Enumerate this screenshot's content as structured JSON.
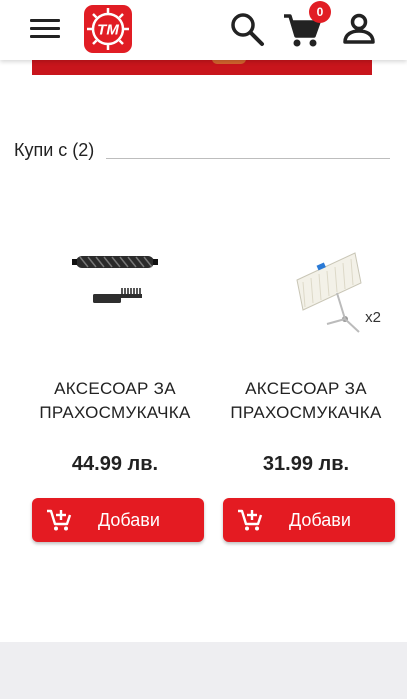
{
  "header": {
    "logo_text": "TM",
    "cart_count": "0",
    "icons": {
      "menu": "hamburger-menu-icon",
      "search": "search-icon",
      "cart": "shopping-cart-icon",
      "account": "account-icon"
    }
  },
  "section": {
    "title": "Купи с (2)"
  },
  "products": [
    {
      "name": "АКСЕСОАР ЗА ПРАХОСМУКАЧКА",
      "price": "44.99 лв.",
      "button_label": "Добави",
      "image": "roller-brush-and-cleaning-tool"
    },
    {
      "name": "АКСЕСОАР ЗА ПРАХОСМУКАЧКА",
      "price": "31.99 лв.",
      "button_label": "Добави",
      "image": "filter-and-side-brush",
      "image_label": "x2"
    }
  ],
  "colors": {
    "brand_red": "#e11d24",
    "button_red": "#e41b22",
    "banner_red": "#c8151c"
  }
}
